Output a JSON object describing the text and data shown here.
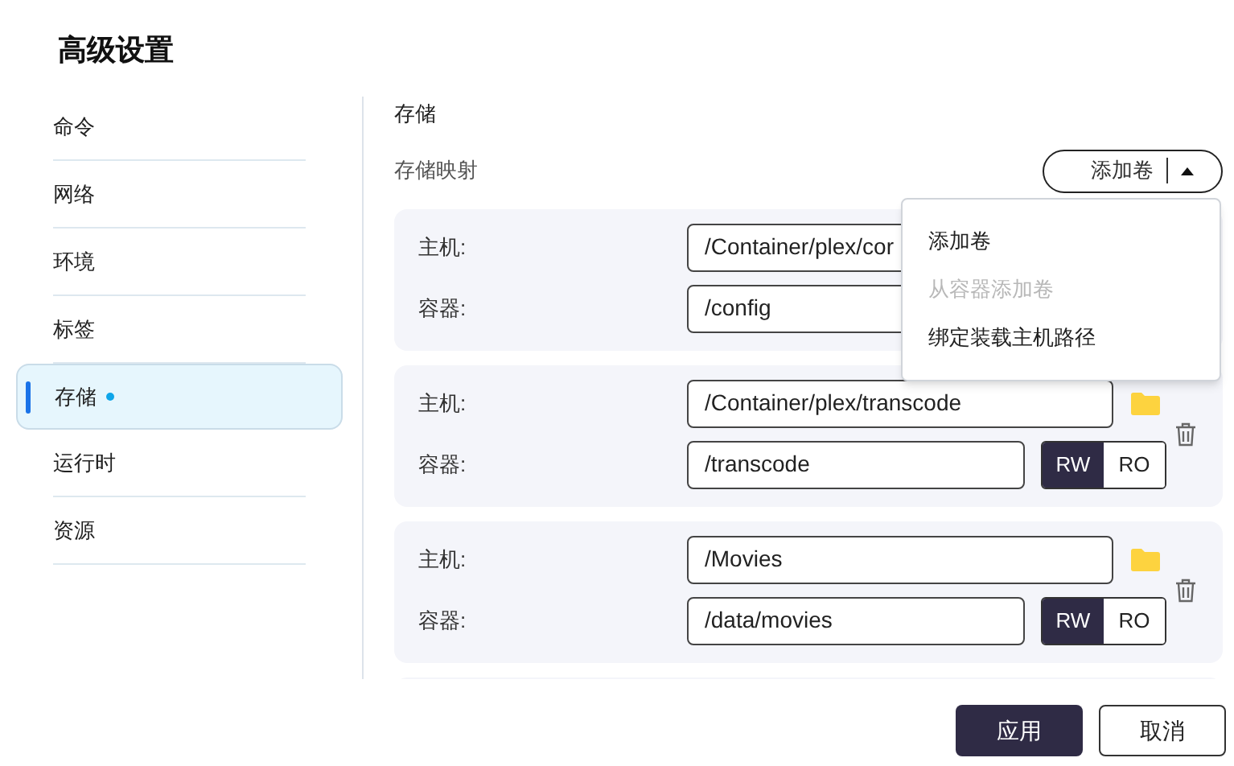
{
  "dialog": {
    "title": "高级设置"
  },
  "sidebar": {
    "items": [
      {
        "label": "命令",
        "selected": false,
        "modified": false
      },
      {
        "label": "网络",
        "selected": false,
        "modified": false
      },
      {
        "label": "环境",
        "selected": false,
        "modified": false
      },
      {
        "label": "标签",
        "selected": false,
        "modified": false
      },
      {
        "label": "存储",
        "selected": true,
        "modified": true
      },
      {
        "label": "运行时",
        "selected": false,
        "modified": false
      },
      {
        "label": "资源",
        "selected": false,
        "modified": false
      }
    ]
  },
  "storage": {
    "heading": "存储",
    "subheading": "存储映射",
    "add_button": {
      "label": "添加卷",
      "expanded": true
    },
    "menu": [
      {
        "label": "添加卷",
        "disabled": false
      },
      {
        "label": "从容器添加卷",
        "disabled": true
      },
      {
        "label": "绑定装载主机路径",
        "disabled": false
      }
    ],
    "mappings": [
      {
        "host_label": "主机:",
        "host": "/Container/plex/cor",
        "container_label": "容器:",
        "container": "/config"
      },
      {
        "host_label": "主机:",
        "host": "/Container/plex/transcode",
        "container_label": "容器:",
        "container": "/transcode",
        "access": [
          {
            "label": "RW",
            "selected": true
          },
          {
            "label": "RO",
            "selected": false
          }
        ]
      },
      {
        "host_label": "主机:",
        "host": "/Movies",
        "container_label": "容器:",
        "container": "/data/movies",
        "access": [
          {
            "label": "RW",
            "selected": true
          },
          {
            "label": "RO",
            "selected": false
          }
        ]
      }
    ]
  },
  "footer": {
    "buttons": [
      {
        "label": "应用",
        "kind": "primary"
      },
      {
        "label": "取消",
        "kind": "secondary"
      }
    ]
  }
}
